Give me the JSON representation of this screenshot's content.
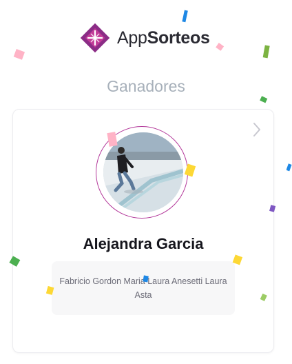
{
  "header": {
    "brand_regular": "App",
    "brand_bold": "Sorteos",
    "logo_colors": [
      "#8b2c86",
      "#c23b98"
    ]
  },
  "section": {
    "title": "Ganadores"
  },
  "winner": {
    "name": "Alejandra Garcia",
    "ring_color": "#b3389a",
    "participants": "Fabricio Gordon Maria Laura Anesetti Laura Asta"
  },
  "icons": {
    "next": "chevron-right-icon",
    "avatar": "winner-photo",
    "logo": "appsorteos-logo-icon"
  },
  "confetti_colors": [
    "#ffb3c6",
    "#1e88e5",
    "#7cb342",
    "#fdd835",
    "#7e57c2",
    "#4caf50"
  ]
}
